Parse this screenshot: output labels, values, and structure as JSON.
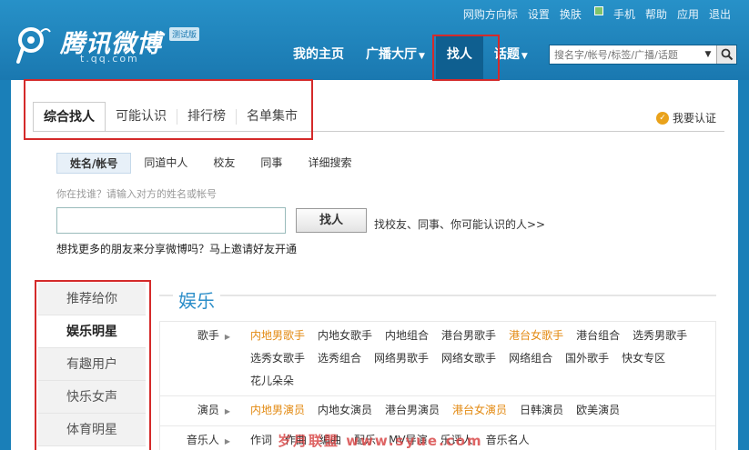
{
  "toplinks": [
    "网购方向标",
    "设置",
    "换肤",
    "手机",
    "帮助",
    "应用",
    "退出"
  ],
  "logo": {
    "name": "腾讯微博",
    "sub": "t.qq.com",
    "badge": "测试版"
  },
  "nav": [
    {
      "label": "我的主页",
      "caret": false
    },
    {
      "label": "广播大厅",
      "caret": true
    },
    {
      "label": "找人",
      "caret": false
    },
    {
      "label": "话题",
      "caret": true
    }
  ],
  "search": {
    "placeholder": "搜名字/帐号/标签/广播/话题"
  },
  "tabs": [
    "综合找人",
    "可能认识",
    "排行榜",
    "名单集市"
  ],
  "verify_label": "我要认证",
  "subtabs": [
    "姓名/帐号",
    "同道中人",
    "校友",
    "同事",
    "详细搜索"
  ],
  "hint": "你在找谁？请输入对方的姓名或帐号",
  "find_button": "找人",
  "find_link": "找校友、同事、你可能认识的人>>",
  "invite_text": "想找更多的朋友来分享微博吗？马上邀请好友开通",
  "sidenav": [
    "推荐给你",
    "娱乐明星",
    "有趣用户",
    "快乐女声",
    "体育明星"
  ],
  "section_title": "娱乐",
  "categories": [
    {
      "name": "歌手",
      "links": [
        {
          "t": "内地男歌手",
          "hl": true
        },
        {
          "t": "内地女歌手"
        },
        {
          "t": "内地组合"
        },
        {
          "t": "港台男歌手"
        },
        {
          "t": "港台女歌手",
          "hl": true
        },
        {
          "t": "港台组合"
        },
        {
          "t": "选秀男歌手"
        },
        {
          "t": "选秀女歌手"
        },
        {
          "t": "选秀组合"
        },
        {
          "t": "网络男歌手"
        },
        {
          "t": "网络女歌手"
        },
        {
          "t": "网络组合"
        },
        {
          "t": "国外歌手"
        },
        {
          "t": "快女专区"
        },
        {
          "t": "花儿朵朵"
        }
      ]
    },
    {
      "name": "演员",
      "links": [
        {
          "t": "内地男演员",
          "hl": true
        },
        {
          "t": "内地女演员"
        },
        {
          "t": "港台男演员"
        },
        {
          "t": "港台女演员",
          "hl": true
        },
        {
          "t": "日韩演员"
        },
        {
          "t": "欧美演员"
        }
      ]
    },
    {
      "name": "音乐人",
      "links": [
        {
          "t": "作词"
        },
        {
          "t": "作曲"
        },
        {
          "t": "编曲"
        },
        {
          "t": "配乐"
        },
        {
          "t": "MV导演"
        },
        {
          "t": "乐评人"
        },
        {
          "t": "音乐名人"
        }
      ]
    }
  ],
  "watermark": "岁月联盟 www.syue.com",
  "colors": {
    "header": "#1a78b0",
    "highlight_box": "#d42a2a",
    "link_highlight": "#e38a12",
    "section_title": "#2b8ec9"
  }
}
